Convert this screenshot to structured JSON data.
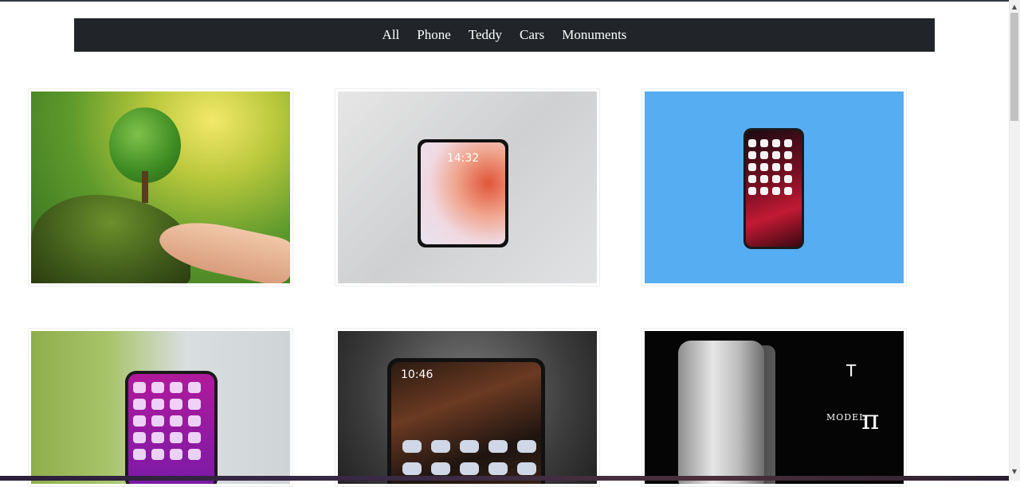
{
  "nav": {
    "items": [
      {
        "label": "All"
      },
      {
        "label": "Phone"
      },
      {
        "label": "Teddy"
      },
      {
        "label": "Cars"
      },
      {
        "label": "Monuments"
      }
    ]
  },
  "gallery": {
    "images": [
      {
        "subject": "tree-in-hand"
      },
      {
        "subject": "phone-on-sheet",
        "screen_time": "14:32"
      },
      {
        "subject": "iphone-on-blue"
      },
      {
        "subject": "iphone-on-path"
      },
      {
        "subject": "phone-dark",
        "screen_time": "10:46"
      },
      {
        "subject": "tesla-model-pi",
        "brand_text": "MODEL",
        "pi_glyph": "π"
      }
    ]
  },
  "colors": {
    "navbar_bg": "#212529",
    "nav_text": "#ffffff",
    "page_bg": "#ffffff"
  },
  "icons": {
    "tesla": "tesla-logo-icon",
    "scroll_up": "scroll-up-arrow-icon",
    "scroll_down": "scroll-down-arrow-icon"
  }
}
